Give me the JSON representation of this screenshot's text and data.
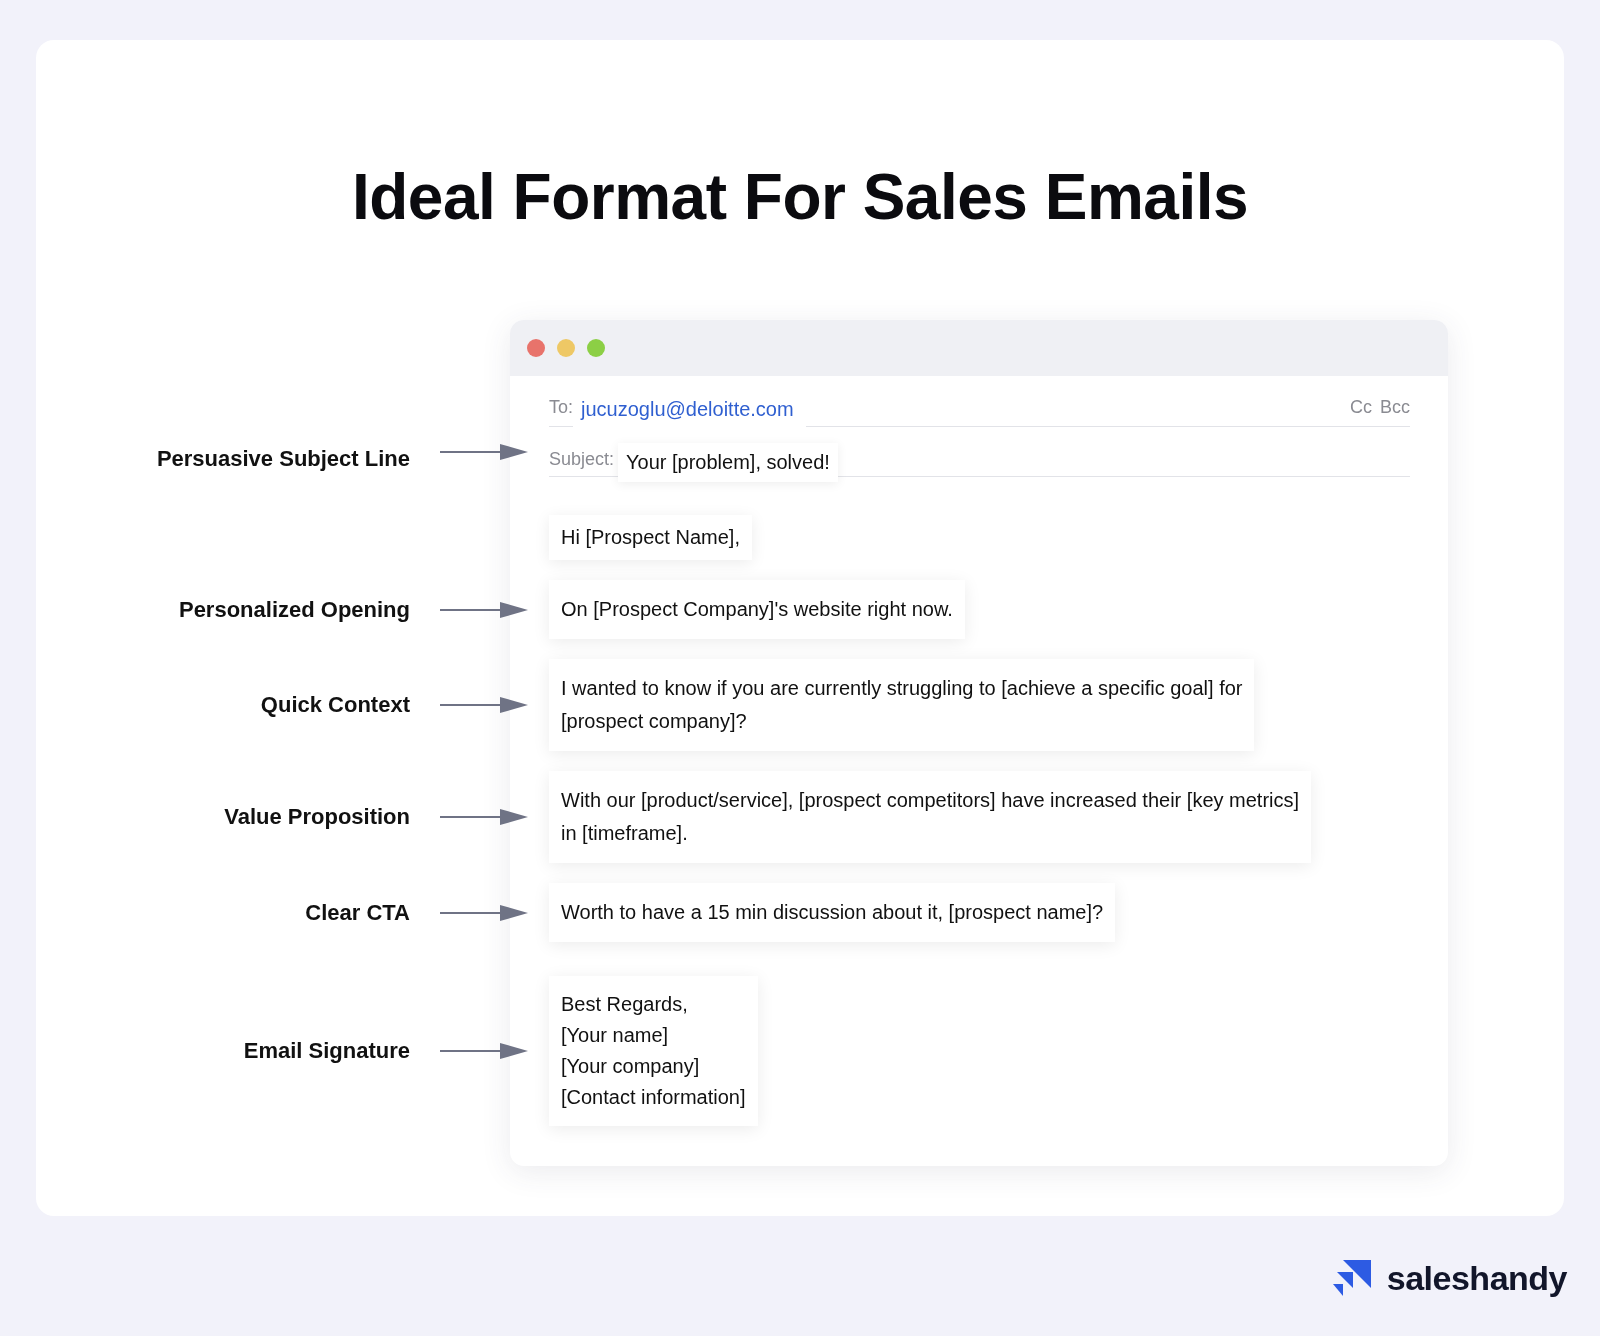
{
  "title": "Ideal Format For Sales Emails",
  "email": {
    "window_buttons": [
      {
        "color": "#e8736b"
      },
      {
        "color": "#eec865"
      },
      {
        "color": "#8ccf45"
      }
    ],
    "to_label": "To:",
    "to": "jucuzoglu@deloitte.com",
    "cc": "Cc",
    "bcc": "Bcc",
    "subject_label": "Subject:",
    "subject": "Your [problem], solved!",
    "subject_annotation": "Persuasive Subject Line",
    "sections": [
      {
        "lines": [
          "Hi [Prospect Name],"
        ]
      },
      {
        "annotation": "Personalized Opening",
        "lines": [
          "On [Prospect Company]'s website right now."
        ]
      },
      {
        "annotation": "Quick Context",
        "lines": [
          "I wanted to know if you are currently struggling to [achieve a specific goal] for",
          "[prospect company]?"
        ]
      },
      {
        "annotation": "Value Proposition",
        "lines": [
          "With our [product/service], [prospect competitors] have increased their [key metrics]",
          "in [timeframe]."
        ]
      },
      {
        "annotation": "Clear CTA",
        "lines": [
          "Worth to have a 15 min discussion about it, [prospect name]?"
        ]
      },
      {
        "annotation": "Email Signature",
        "lines": [
          "Best Regards,",
          "[Your name]",
          "[Your company]",
          "[Contact information]"
        ]
      }
    ]
  },
  "brand": {
    "name": "saleshandy"
  }
}
